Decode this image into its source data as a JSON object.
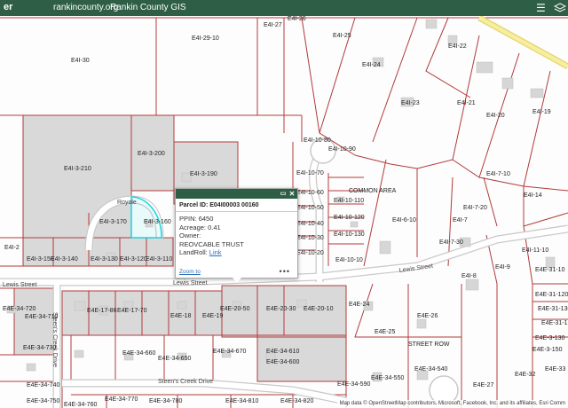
{
  "header": {
    "title": "er",
    "link_county": "rankincounty.org",
    "link_gis": "Rankin County GIS",
    "menu_icon": "menu-icon",
    "layers_icon": "layers-icon"
  },
  "map": {
    "parcel_labels": [
      "E4I-29-10",
      "E4I-27",
      "E4I-26",
      "E4I-25",
      "E4I-30",
      "E4I-24",
      "E4I-22",
      "E4I-23",
      "E4I-21",
      "E4I-20",
      "E4I-19",
      "E4I-10-80",
      "E4I-10-90",
      "E4I-3-200",
      "E4I-3-210",
      "E4I-3-190",
      "E4I-10-70",
      "E4I-10-60",
      "E4I-10-110",
      "E4I-10-120",
      "E4I-10-130",
      "E4I-10-50",
      "E4I-10-40",
      "E4I-10-30",
      "E4I-10-20",
      "E4I-10-10",
      "E4I-6-10",
      "E4I-7-20",
      "E4I-7",
      "E4I-7-30",
      "E4I-7-10",
      "E4I-14",
      "E4I-11-10",
      "E4I-9",
      "E4I-8",
      "E4E-31-10",
      "E4E-31-120",
      "E4E-31-130",
      "E4E-31-170",
      "E4E-3-130",
      "E4E-3-150",
      "E4I-3-170",
      "E4I-3-160",
      "E4I-3-150",
      "E4I-3-140",
      "E4I-3-130",
      "E4I-3-120",
      "E4I-3-110",
      "E4I-2",
      "E4E-34-720",
      "E4E-34-710",
      "E4E-17-86",
      "E4E-17-70",
      "E4E-18",
      "E4E-19",
      "E4E-20-50",
      "E4E-20-30",
      "E4E-20-10",
      "E4E-24",
      "E4E-25",
      "E4E-26",
      "E4E-27",
      "E4E-32",
      "E4E-33",
      "E4E-34-730",
      "E4E-34-660",
      "E4E-34-650",
      "E4E-34-670",
      "E4E-34-610",
      "E4E-34-600",
      "E4E-34-540",
      "E4E-34-550",
      "E4E-34-590",
      "E4E-34-740",
      "E4E-34-750",
      "E4E-34-760",
      "E4E-34-770",
      "E4E-34-780",
      "E4E-34-810",
      "E4E-34-820"
    ],
    "street_labels": {
      "lewis_w": "Lewis Street",
      "lewis_mid": "Lewis Street",
      "lewis_e": "Lewis Street",
      "steens": "Steen's Creek Drive",
      "steens_vert": "Steen's Creek Drive",
      "royale": "Royale",
      "street_row": "STREET ROW",
      "common_area": "COMMON AREA"
    }
  },
  "popup": {
    "title": "Parcel ID: E04I00003 00160",
    "ppin_label": "PPIN:",
    "ppin": "6450",
    "acreage_label": "Acreage:",
    "acreage": "0.41",
    "owner_label": "Owner:",
    "owner": "REOVCABLE TRUST",
    "landroll_label": "LandRoll:",
    "landroll_link": "Link",
    "zoom_label": "Zoom to",
    "more": "•••"
  },
  "attribution": "Map data © OpenStreetMap contributors, Microsoft, Facebook, Inc. and its affiliates, Esri Comm"
}
